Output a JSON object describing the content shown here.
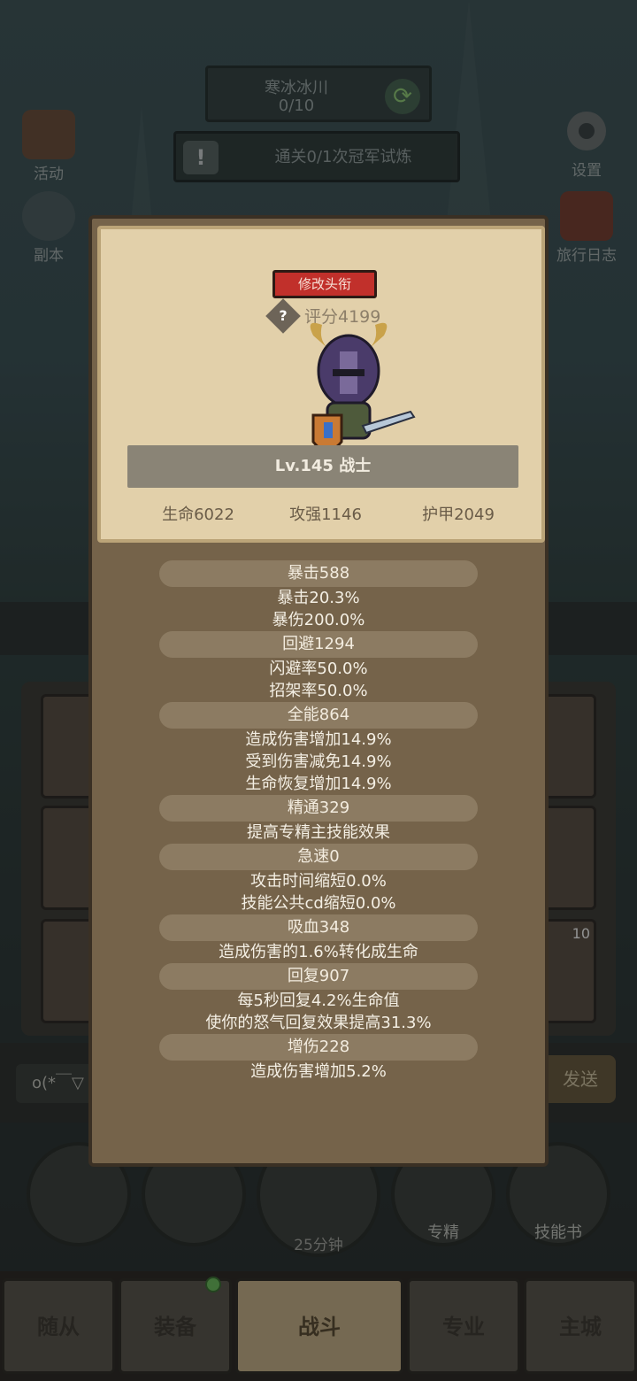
{
  "scene": {
    "location_name": "寒冰冰川",
    "location_progress": "0/10",
    "quest_text": "通关0/1次冠军试炼",
    "left_buttons": [
      {
        "label": "活动",
        "icon": "event-book-icon"
      },
      {
        "label": "副本",
        "icon": "dungeon-portal-icon"
      }
    ],
    "right_buttons": [
      {
        "label": "设置",
        "icon": "gear-icon"
      },
      {
        "label": "旅行日志",
        "icon": "journal-icon"
      }
    ],
    "chat_placeholder": "o(*￣▽",
    "send_label": "发送",
    "action_buttons": [
      {
        "label": "",
        "icon": "potion-icon"
      },
      {
        "label": "",
        "icon": "bread-icon"
      },
      {
        "label": "",
        "icon": "treasure-chest-icon"
      },
      {
        "label": "专精",
        "icon": "specialization-icon"
      },
      {
        "label": "技能书",
        "icon": "skill-book-icon"
      }
    ],
    "chest_timer": "25分钟",
    "slot_badge": "10",
    "nav_tabs": [
      "随从",
      "装备",
      "战斗",
      "专业",
      "主城"
    ],
    "active_tab": "战斗"
  },
  "card": {
    "rename_label": "修改头衔",
    "score_label": "评分4199",
    "level_class": "Lv.145 战士",
    "stats": [
      "生命6022",
      "攻强1146",
      "护甲2049"
    ],
    "attributes": [
      {
        "title": "暴击588",
        "lines": [
          "暴击20.3%",
          "暴伤200.0%"
        ]
      },
      {
        "title": "回避1294",
        "lines": [
          "闪避率50.0%",
          "招架率50.0%"
        ]
      },
      {
        "title": "全能864",
        "lines": [
          "造成伤害增加14.9%",
          "受到伤害减免14.9%",
          "生命恢复增加14.9%"
        ]
      },
      {
        "title": "精通329",
        "lines": [
          "提高专精主技能效果"
        ]
      },
      {
        "title": "急速0",
        "lines": [
          "攻击时间缩短0.0%",
          "技能公共cd缩短0.0%"
        ]
      },
      {
        "title": "吸血348",
        "lines": [
          "造成伤害的1.6%转化成生命"
        ]
      },
      {
        "title": "回复907",
        "lines": [
          "每5秒回复4.2%生命值",
          "使你的怒气回复效果提高31.3%"
        ]
      },
      {
        "title": "增伤228",
        "lines": [
          "造成伤害增加5.2%"
        ]
      }
    ]
  },
  "colors": {
    "rename_button": "#c1302b",
    "parchment": "#e2d0aa",
    "card_body": "#75634a",
    "notification_dot": "#6cc15b"
  }
}
